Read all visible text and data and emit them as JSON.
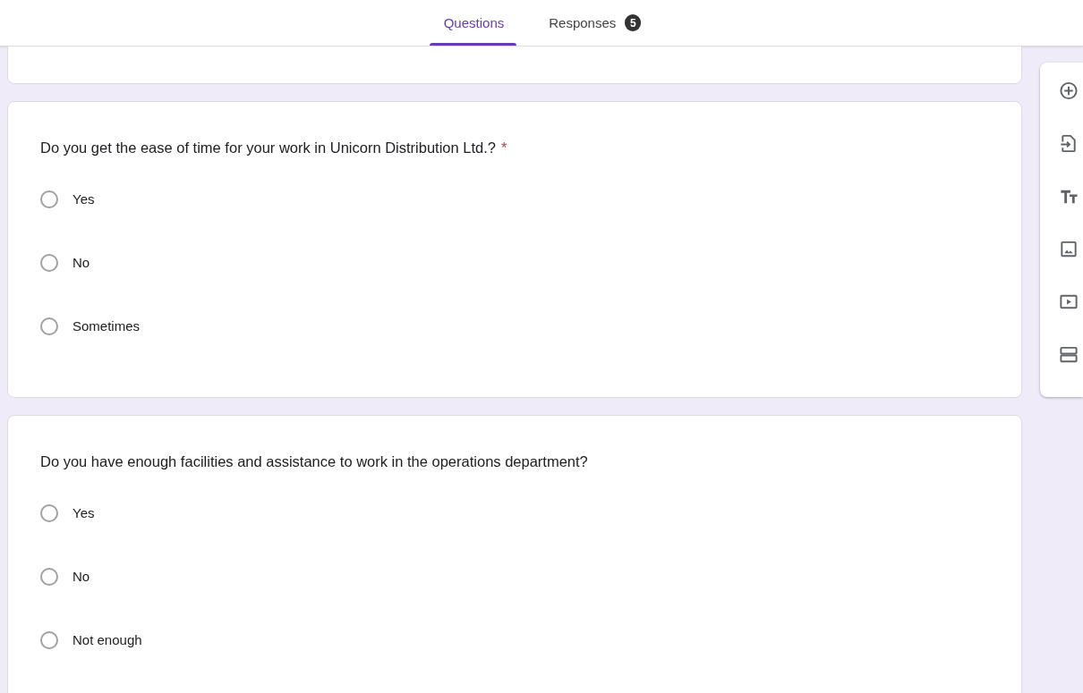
{
  "tabs": [
    {
      "label": "Questions",
      "selected": true
    },
    {
      "label": "Responses",
      "selected": false,
      "badge": "5"
    }
  ],
  "questions": [
    {
      "text": "Do you get the ease of time for your work in Unicorn Distribution Ltd.?",
      "required_mark": "*",
      "options": [
        {
          "label": "Yes",
          "selected": false
        },
        {
          "label": "No",
          "selected": false
        },
        {
          "label": "Sometimes",
          "selected": false
        }
      ]
    },
    {
      "text": "Do you have enough facilities and assistance to work in the operations department?",
      "options": [
        {
          "label": "Yes",
          "selected": false
        },
        {
          "label": "No",
          "selected": false
        },
        {
          "label": "Not enough",
          "selected": false
        }
      ]
    }
  ]
}
